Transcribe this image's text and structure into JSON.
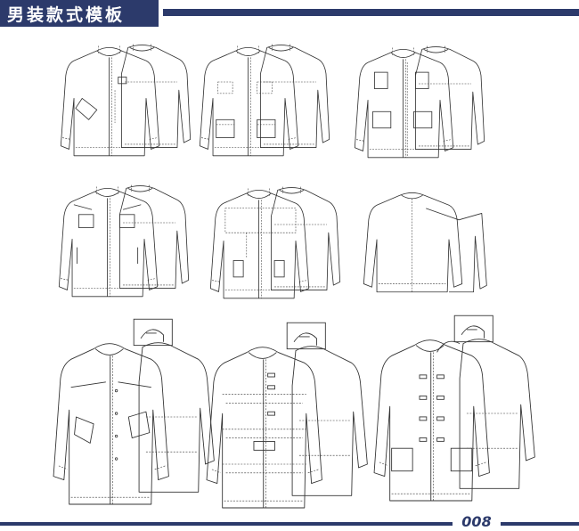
{
  "header": {
    "title": "男装款式模板"
  },
  "footer": {
    "page_number": "008"
  },
  "colors": {
    "brand": "#2c3a6b",
    "line": "#333333"
  },
  "sketches": [
    {
      "name": "jacket-sketch-1",
      "style": "jacket"
    },
    {
      "name": "jacket-sketch-2",
      "style": "jacket"
    },
    {
      "name": "jacket-sketch-3",
      "style": "jacket"
    },
    {
      "name": "jacket-sketch-4",
      "style": "jacket"
    },
    {
      "name": "jacket-sketch-5",
      "style": "jacket"
    },
    {
      "name": "jacket-sketch-6",
      "style": "jacket"
    },
    {
      "name": "coat-sketch-1",
      "style": "coat"
    },
    {
      "name": "coat-sketch-2",
      "style": "coat"
    },
    {
      "name": "coat-sketch-3",
      "style": "coat"
    }
  ]
}
